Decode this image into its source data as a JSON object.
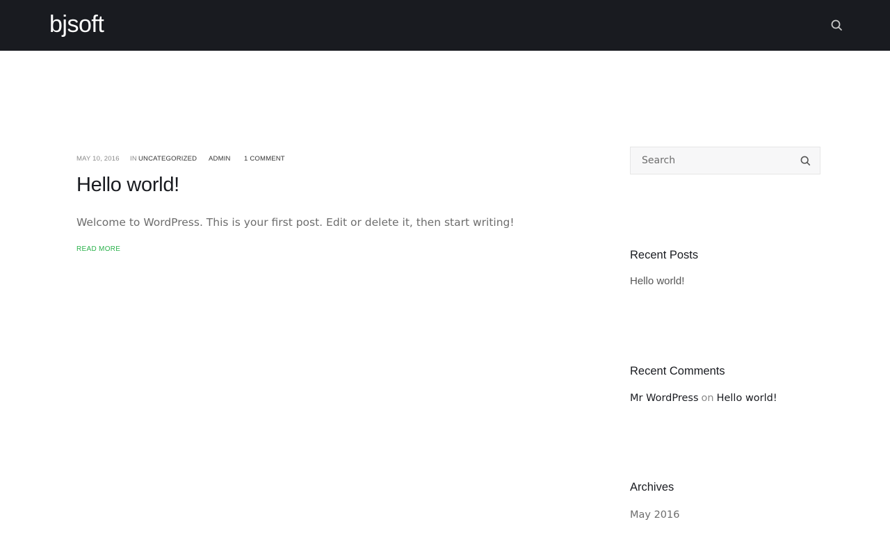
{
  "header": {
    "logo": "bjsoft",
    "search_icon": "search-icon"
  },
  "post": {
    "date": "May 10, 2016",
    "in_label": "In",
    "category": "Uncategorized",
    "author": "admin",
    "comments": "1 Comment",
    "title": "Hello world!",
    "excerpt": "Welcome to WordPress. This is your first post. Edit or delete it, then start writing!",
    "read_more": "Read More"
  },
  "sidebar": {
    "search": {
      "placeholder": "Search",
      "value": "",
      "button_icon": "search-icon"
    },
    "recent_posts": {
      "title": "Recent Posts",
      "items": [
        "Hello world!"
      ]
    },
    "recent_comments": {
      "title": "Recent Comments",
      "items": [
        {
          "author": "Mr WordPress",
          "on": "on",
          "post": "Hello world!"
        }
      ]
    },
    "archives": {
      "title": "Archives",
      "items": [
        "May 2016"
      ]
    }
  },
  "colors": {
    "header_bg": "#191b20",
    "accent_green": "#2bb24c",
    "text_dark": "#191b20",
    "text_muted": "#6d6d6d"
  }
}
